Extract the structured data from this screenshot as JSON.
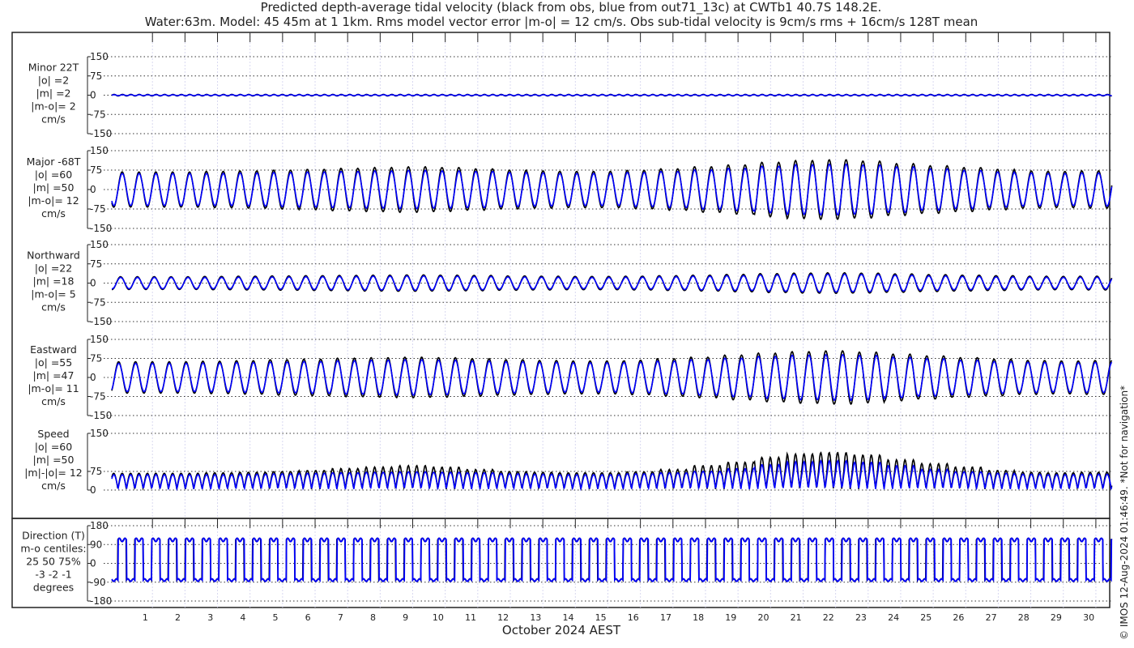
{
  "chart_data": {
    "type": "line",
    "title": "Predicted depth-average tidal velocity (black from obs, blue from out71_13c) at CWTb1 40.7S 148.2E.",
    "subtitle": "Water:63m. Model: 45 45m at 1 1km. Rms model vector error |m-o| = 12 cm/s. Obs sub-tidal velocity is 9cm/s rms + 16cm/s 128T mean",
    "xlabel": "October 2024 AEST",
    "x_ticks": [
      "1",
      "2",
      "3",
      "4",
      "5",
      "6",
      "7",
      "8",
      "9",
      "10",
      "11",
      "12",
      "13",
      "14",
      "15",
      "16",
      "17",
      "18",
      "19",
      "20",
      "21",
      "22",
      "23",
      "24",
      "25",
      "26",
      "27",
      "28",
      "29",
      "30"
    ],
    "xlim_days": [
      0.25,
      31.0
    ],
    "tidal_period_hours": 12.42,
    "grid": true,
    "series_colors": {
      "obs": "#000000",
      "model": "#0000ff"
    },
    "panels": [
      {
        "key": "minor",
        "labels": [
          "Minor 22T",
          "|o| =2",
          "|m| =2",
          "|m-o|= 2",
          "cm/s"
        ],
        "yticks": [
          "150",
          "75",
          "0",
          "-75",
          "-150"
        ],
        "ylim": [
          -150,
          150
        ],
        "obs_amp": [
          3,
          3,
          3,
          3,
          3,
          3,
          3,
          3,
          3,
          3,
          3,
          3,
          3,
          3,
          3,
          3,
          3,
          3,
          3,
          3,
          3,
          3,
          3,
          3,
          3,
          3,
          3,
          3,
          3,
          3
        ],
        "model_amp": [
          2,
          2,
          2,
          2,
          2,
          2,
          2,
          2,
          2,
          2,
          2,
          2,
          2,
          2,
          2,
          2,
          2,
          2,
          2,
          2,
          2,
          2,
          2,
          2,
          2,
          2,
          2,
          2,
          2,
          2
        ]
      },
      {
        "key": "major",
        "labels": [
          "Major -68T",
          "|o| =60",
          "|m| =50",
          "|m-o|= 12",
          "cm/s"
        ],
        "yticks": [
          "150",
          "75",
          "0",
          "-75",
          "-150"
        ],
        "ylim": [
          -150,
          150
        ],
        "obs_amp": [
          68,
          68,
          70,
          72,
          75,
          78,
          82,
          85,
          88,
          85,
          80,
          75,
          72,
          70,
          70,
          74,
          80,
          88,
          95,
          105,
          112,
          115,
          110,
          100,
          92,
          85,
          78,
          72,
          70,
          72
        ],
        "model_amp": [
          62,
          62,
          62,
          64,
          66,
          68,
          70,
          72,
          74,
          72,
          70,
          66,
          64,
          62,
          62,
          66,
          70,
          76,
          82,
          90,
          96,
          98,
          95,
          88,
          80,
          74,
          68,
          64,
          62,
          64
        ]
      },
      {
        "key": "northward",
        "labels": [
          "Northward",
          "|o| =22",
          "|m| =18",
          "|m-o|= 5",
          "cm/s"
        ],
        "yticks": [
          "150",
          "75",
          "0",
          "-75",
          "-150"
        ],
        "ylim": [
          -150,
          150
        ],
        "obs_amp": [
          25,
          25,
          26,
          27,
          28,
          29,
          30,
          31,
          32,
          31,
          30,
          28,
          27,
          26,
          26,
          27,
          29,
          31,
          34,
          37,
          39,
          40,
          39,
          36,
          33,
          31,
          29,
          27,
          26,
          27
        ],
        "model_amp": [
          22,
          22,
          22,
          23,
          24,
          25,
          26,
          27,
          28,
          27,
          26,
          24,
          23,
          22,
          22,
          23,
          25,
          27,
          29,
          32,
          34,
          35,
          34,
          31,
          28,
          26,
          24,
          23,
          22,
          23
        ]
      },
      {
        "key": "eastward",
        "labels": [
          "Eastward",
          "|o| =55",
          "|m| =47",
          "|m-o|= 11",
          "cm/s"
        ],
        "yticks": [
          "150",
          "75",
          "0",
          "-75",
          "-150"
        ],
        "ylim": [
          -150,
          150
        ],
        "obs_amp": [
          62,
          62,
          64,
          66,
          70,
          72,
          76,
          78,
          80,
          78,
          74,
          70,
          67,
          65,
          65,
          68,
          74,
          80,
          88,
          96,
          102,
          105,
          100,
          92,
          85,
          78,
          72,
          67,
          65,
          67
        ],
        "model_amp": [
          56,
          56,
          57,
          59,
          61,
          63,
          66,
          68,
          70,
          68,
          65,
          62,
          60,
          58,
          58,
          61,
          65,
          70,
          76,
          83,
          88,
          90,
          87,
          80,
          74,
          68,
          63,
          60,
          58,
          60
        ]
      },
      {
        "key": "speed",
        "labels": [
          "Speed",
          "|o| =60",
          "|m| =50",
          "|m|-|o|= 12",
          "cm/s"
        ],
        "yticks": [
          "150",
          "75",
          "0"
        ],
        "ylim": [
          0,
          150
        ],
        "obs_amp": [
          68,
          68,
          70,
          72,
          75,
          78,
          82,
          85,
          88,
          85,
          80,
          75,
          72,
          70,
          70,
          74,
          80,
          88,
          95,
          105,
          112,
          115,
          110,
          100,
          92,
          85,
          78,
          72,
          70,
          72
        ],
        "model_amp": [
          62,
          62,
          62,
          64,
          66,
          68,
          70,
          72,
          74,
          72,
          70,
          66,
          64,
          62,
          62,
          66,
          70,
          76,
          82,
          90,
          96,
          98,
          95,
          88,
          80,
          74,
          68,
          64,
          62,
          64
        ]
      },
      {
        "key": "direction",
        "labels": [
          "Direction (T)",
          "m-o centiles:",
          "25  50  75%",
          "-3 -2 -1",
          "degrees"
        ],
        "yticks": [
          "180",
          "90",
          "0",
          "-90",
          "-180"
        ],
        "ylim": [
          -180,
          180
        ],
        "flood_deg": 112,
        "ebb_deg": -80
      }
    ]
  },
  "footer": {
    "copyright": "© IMOS 12-Aug-2024 01:46:49. *Not for navigation*"
  }
}
